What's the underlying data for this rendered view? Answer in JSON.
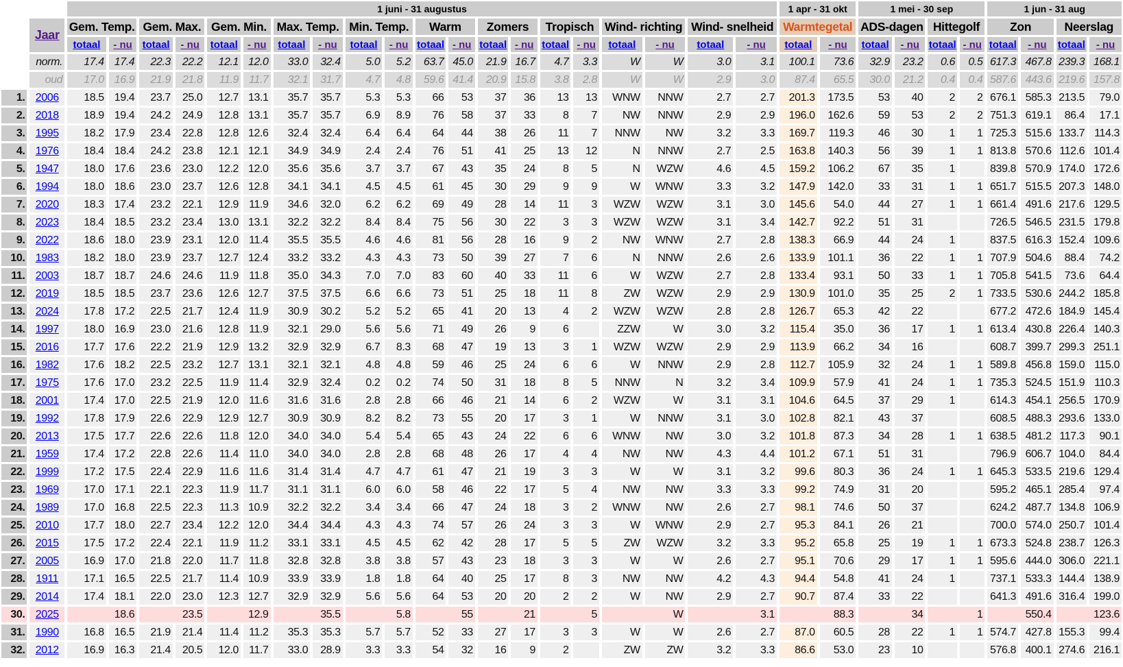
{
  "periods": [
    {
      "label": "1 juni - 31 augustus",
      "span": 10
    },
    {
      "label": "1 apr - 31 okt",
      "span": 1
    },
    {
      "label": "1 mei - 30 sep",
      "span": 2
    },
    {
      "label": "1 jun - 31 aug",
      "span": 2
    }
  ],
  "year_header": "Jaar",
  "columns": [
    "Gem. Temp.",
    "Gem. Max.",
    "Gem. Min.",
    "Max. Temp.",
    "Min. Temp.",
    "Warm",
    "Zomers",
    "Tropisch",
    "Wind- richting",
    "Wind- snelheid",
    "Warmtegetal",
    "ADS-dagen",
    "Hittegolf",
    "Zon",
    "Neerslag"
  ],
  "highlight_column": "Warmtegetal",
  "sub_labels": {
    "total": "totaal",
    "nu": "- nu"
  },
  "colors": {
    "header_bg": "#cccccc",
    "cell_bg": "#efefef",
    "highlight_text": "#d9541e",
    "highlight_cell": "#fdeedd",
    "current_row": "#ffdcdc"
  },
  "norm": {
    "label": "norm.",
    "values": [
      "17.4",
      "17.4",
      "22.3",
      "22.2",
      "12.1",
      "12.0",
      "33.0",
      "32.4",
      "5.0",
      "5.2",
      "63.7",
      "45.0",
      "21.9",
      "16.7",
      "4.7",
      "3.3",
      "W",
      "W",
      "3.0",
      "3.1",
      "100.1",
      "73.6",
      "32.9",
      "23.2",
      "0.6",
      "0.5",
      "617.3",
      "467.8",
      "239.3",
      "168.1"
    ]
  },
  "oud": {
    "label": "oud",
    "values": [
      "17.0",
      "16.9",
      "21.9",
      "21.8",
      "11.9",
      "11.7",
      "32.1",
      "31.7",
      "4.7",
      "4.8",
      "59.6",
      "41.4",
      "20.9",
      "15.8",
      "3.8",
      "2.8",
      "W",
      "W",
      "2.9",
      "3.0",
      "87.4",
      "65.5",
      "30.0",
      "21.2",
      "0.4",
      "0.4",
      "587.6",
      "443.6",
      "219.6",
      "157.8"
    ]
  },
  "rows": [
    {
      "rank": "1.",
      "year": "2006",
      "v": [
        "18.5",
        "19.4",
        "23.7",
        "25.0",
        "12.7",
        "13.1",
        "35.7",
        "35.7",
        "5.3",
        "5.3",
        "66",
        "53",
        "37",
        "36",
        "13",
        "13",
        "WNW",
        "NNW",
        "2.7",
        "2.7",
        "201.3",
        "173.5",
        "53",
        "40",
        "2",
        "2",
        "676.1",
        "585.3",
        "213.5",
        "79.0"
      ]
    },
    {
      "rank": "2.",
      "year": "2018",
      "v": [
        "18.9",
        "19.4",
        "24.2",
        "24.9",
        "12.8",
        "13.1",
        "35.7",
        "35.7",
        "6.9",
        "8.9",
        "76",
        "58",
        "37",
        "33",
        "8",
        "7",
        "NW",
        "NNW",
        "2.9",
        "2.9",
        "196.0",
        "162.6",
        "59",
        "53",
        "2",
        "2",
        "751.3",
        "619.1",
        "86.4",
        "17.1"
      ]
    },
    {
      "rank": "3.",
      "year": "1995",
      "v": [
        "18.2",
        "17.9",
        "23.4",
        "22.8",
        "12.8",
        "12.6",
        "32.4",
        "32.4",
        "6.4",
        "6.4",
        "64",
        "44",
        "38",
        "26",
        "11",
        "7",
        "NNW",
        "NW",
        "3.2",
        "3.3",
        "169.7",
        "119.3",
        "46",
        "30",
        "1",
        "1",
        "725.3",
        "515.6",
        "133.7",
        "114.3"
      ]
    },
    {
      "rank": "4.",
      "year": "1976",
      "v": [
        "18.4",
        "18.4",
        "24.2",
        "23.8",
        "12.1",
        "12.1",
        "34.9",
        "34.9",
        "2.4",
        "2.4",
        "76",
        "51",
        "41",
        "25",
        "13",
        "12",
        "N",
        "NNW",
        "2.7",
        "2.5",
        "163.8",
        "140.3",
        "56",
        "39",
        "1",
        "1",
        "813.8",
        "570.6",
        "112.6",
        "101.4"
      ]
    },
    {
      "rank": "5.",
      "year": "1947",
      "v": [
        "18.0",
        "17.6",
        "23.6",
        "23.0",
        "12.2",
        "12.0",
        "35.6",
        "35.6",
        "3.7",
        "3.7",
        "67",
        "43",
        "35",
        "24",
        "8",
        "5",
        "N",
        "WZW",
        "4.6",
        "4.5",
        "159.2",
        "106.2",
        "67",
        "35",
        "1",
        "",
        "839.8",
        "570.9",
        "174.0",
        "172.6"
      ]
    },
    {
      "rank": "6.",
      "year": "1994",
      "v": [
        "18.0",
        "18.6",
        "23.0",
        "23.7",
        "12.6",
        "12.8",
        "34.1",
        "34.1",
        "4.5",
        "4.5",
        "61",
        "45",
        "30",
        "29",
        "9",
        "9",
        "W",
        "WNW",
        "3.3",
        "3.2",
        "147.9",
        "142.0",
        "33",
        "31",
        "1",
        "1",
        "651.7",
        "515.5",
        "207.3",
        "148.0"
      ]
    },
    {
      "rank": "7.",
      "year": "2020",
      "v": [
        "18.3",
        "17.4",
        "23.2",
        "22.1",
        "12.9",
        "11.9",
        "34.6",
        "32.0",
        "6.2",
        "6.2",
        "69",
        "49",
        "28",
        "14",
        "11",
        "3",
        "WZW",
        "WZW",
        "3.1",
        "3.0",
        "145.6",
        "54.0",
        "44",
        "27",
        "1",
        "1",
        "661.4",
        "491.6",
        "217.6",
        "129.5"
      ]
    },
    {
      "rank": "8.",
      "year": "2023",
      "v": [
        "18.4",
        "18.5",
        "23.2",
        "23.4",
        "13.0",
        "13.1",
        "32.2",
        "32.2",
        "8.4",
        "8.4",
        "75",
        "56",
        "30",
        "22",
        "3",
        "3",
        "WZW",
        "WZW",
        "3.1",
        "3.4",
        "142.7",
        "92.2",
        "51",
        "31",
        "",
        "",
        "726.5",
        "546.5",
        "231.5",
        "179.8"
      ]
    },
    {
      "rank": "9.",
      "year": "2022",
      "v": [
        "18.6",
        "18.0",
        "23.9",
        "23.1",
        "12.0",
        "11.4",
        "35.5",
        "35.5",
        "4.6",
        "4.6",
        "81",
        "56",
        "28",
        "16",
        "9",
        "2",
        "NW",
        "WNW",
        "2.7",
        "2.8",
        "138.3",
        "66.9",
        "44",
        "24",
        "1",
        "",
        "837.5",
        "616.3",
        "152.4",
        "109.6"
      ]
    },
    {
      "rank": "10.",
      "year": "1983",
      "v": [
        "18.2",
        "18.0",
        "23.9",
        "23.7",
        "12.7",
        "12.4",
        "33.2",
        "33.2",
        "4.3",
        "4.3",
        "73",
        "50",
        "39",
        "27",
        "7",
        "6",
        "N",
        "NNW",
        "2.6",
        "2.6",
        "133.9",
        "101.1",
        "36",
        "22",
        "1",
        "1",
        "707.9",
        "504.6",
        "88.4",
        "74.2"
      ]
    },
    {
      "rank": "11.",
      "year": "2003",
      "v": [
        "18.7",
        "18.7",
        "24.6",
        "24.6",
        "11.9",
        "11.8",
        "35.0",
        "34.3",
        "7.0",
        "7.0",
        "83",
        "60",
        "40",
        "33",
        "11",
        "6",
        "W",
        "WZW",
        "2.7",
        "2.8",
        "133.4",
        "93.1",
        "50",
        "33",
        "1",
        "1",
        "705.8",
        "541.5",
        "73.6",
        "64.4"
      ]
    },
    {
      "rank": "12.",
      "year": "2019",
      "v": [
        "18.5",
        "18.5",
        "23.7",
        "23.6",
        "12.6",
        "12.7",
        "37.5",
        "37.5",
        "6.6",
        "6.6",
        "73",
        "51",
        "25",
        "18",
        "11",
        "8",
        "ZW",
        "WZW",
        "2.9",
        "2.9",
        "130.9",
        "101.0",
        "35",
        "25",
        "2",
        "1",
        "733.5",
        "530.6",
        "244.2",
        "185.8"
      ]
    },
    {
      "rank": "13.",
      "year": "2024",
      "v": [
        "17.8",
        "17.2",
        "22.5",
        "21.7",
        "12.4",
        "11.9",
        "30.9",
        "30.2",
        "5.2",
        "5.2",
        "65",
        "41",
        "20",
        "13",
        "4",
        "2",
        "WZW",
        "WZW",
        "2.8",
        "2.8",
        "126.7",
        "65.3",
        "42",
        "22",
        "",
        "",
        "677.2",
        "472.6",
        "184.9",
        "145.4"
      ]
    },
    {
      "rank": "14.",
      "year": "1997",
      "v": [
        "18.0",
        "16.9",
        "23.0",
        "21.6",
        "12.8",
        "11.9",
        "32.1",
        "29.0",
        "5.6",
        "5.6",
        "71",
        "49",
        "26",
        "9",
        "6",
        "",
        "ZZW",
        "W",
        "3.0",
        "3.2",
        "115.4",
        "35.0",
        "36",
        "17",
        "1",
        "1",
        "613.4",
        "430.8",
        "226.4",
        "140.3"
      ]
    },
    {
      "rank": "15.",
      "year": "2016",
      "v": [
        "17.7",
        "17.6",
        "22.2",
        "21.9",
        "12.9",
        "13.2",
        "32.9",
        "32.9",
        "6.7",
        "8.3",
        "68",
        "47",
        "19",
        "13",
        "3",
        "1",
        "WZW",
        "WZW",
        "2.9",
        "2.9",
        "113.9",
        "66.2",
        "34",
        "16",
        "",
        "",
        "608.7",
        "399.7",
        "299.3",
        "251.1"
      ]
    },
    {
      "rank": "16.",
      "year": "1982",
      "v": [
        "17.6",
        "18.2",
        "22.5",
        "23.2",
        "12.7",
        "13.1",
        "32.1",
        "32.1",
        "4.8",
        "4.8",
        "59",
        "46",
        "25",
        "24",
        "6",
        "6",
        "W",
        "NNW",
        "2.9",
        "2.8",
        "112.7",
        "105.9",
        "32",
        "24",
        "1",
        "1",
        "589.8",
        "456.8",
        "159.0",
        "115.0"
      ]
    },
    {
      "rank": "17.",
      "year": "1975",
      "v": [
        "17.6",
        "17.0",
        "23.2",
        "22.5",
        "11.9",
        "11.4",
        "32.9",
        "32.4",
        "0.2",
        "0.2",
        "74",
        "50",
        "31",
        "18",
        "8",
        "5",
        "NNW",
        "N",
        "3.2",
        "3.4",
        "109.9",
        "57.9",
        "41",
        "24",
        "1",
        "1",
        "735.3",
        "524.5",
        "151.9",
        "110.3"
      ]
    },
    {
      "rank": "18.",
      "year": "2001",
      "v": [
        "17.4",
        "17.0",
        "22.5",
        "21.9",
        "12.0",
        "11.6",
        "31.6",
        "31.6",
        "2.8",
        "2.8",
        "66",
        "46",
        "21",
        "14",
        "6",
        "2",
        "WZW",
        "W",
        "3.1",
        "3.1",
        "104.6",
        "64.5",
        "37",
        "29",
        "1",
        "",
        "614.3",
        "454.1",
        "256.5",
        "170.9"
      ]
    },
    {
      "rank": "19.",
      "year": "1992",
      "v": [
        "17.8",
        "17.9",
        "22.6",
        "22.9",
        "12.9",
        "12.7",
        "30.9",
        "30.9",
        "8.2",
        "8.2",
        "73",
        "55",
        "20",
        "17",
        "3",
        "1",
        "W",
        "NNW",
        "3.1",
        "3.0",
        "102.8",
        "82.1",
        "43",
        "37",
        "",
        "",
        "608.5",
        "488.3",
        "293.6",
        "133.0"
      ]
    },
    {
      "rank": "20.",
      "year": "2013",
      "v": [
        "17.5",
        "17.7",
        "22.6",
        "22.6",
        "11.8",
        "12.0",
        "34.0",
        "34.0",
        "5.4",
        "5.4",
        "65",
        "43",
        "24",
        "22",
        "6",
        "6",
        "WNW",
        "NW",
        "3.0",
        "3.2",
        "101.8",
        "87.3",
        "34",
        "28",
        "1",
        "1",
        "638.5",
        "481.2",
        "117.3",
        "90.1"
      ]
    },
    {
      "rank": "21.",
      "year": "1959",
      "v": [
        "17.4",
        "17.2",
        "22.8",
        "22.6",
        "11.4",
        "11.0",
        "34.0",
        "34.0",
        "2.8",
        "2.8",
        "68",
        "48",
        "26",
        "17",
        "4",
        "4",
        "NW",
        "NW",
        "4.3",
        "4.4",
        "101.2",
        "67.1",
        "51",
        "31",
        "",
        "",
        "796.9",
        "606.7",
        "104.0",
        "84.4"
      ]
    },
    {
      "rank": "22.",
      "year": "1999",
      "v": [
        "17.2",
        "17.5",
        "22.4",
        "22.9",
        "11.6",
        "11.6",
        "31.4",
        "31.4",
        "4.7",
        "4.7",
        "61",
        "47",
        "21",
        "19",
        "3",
        "3",
        "W",
        "W",
        "3.1",
        "3.2",
        "99.6",
        "80.3",
        "36",
        "24",
        "1",
        "1",
        "645.3",
        "533.5",
        "219.6",
        "129.4"
      ]
    },
    {
      "rank": "23.",
      "year": "1969",
      "v": [
        "17.0",
        "17.1",
        "22.1",
        "22.3",
        "11.9",
        "11.7",
        "31.1",
        "31.1",
        "6.0",
        "6.0",
        "58",
        "46",
        "22",
        "17",
        "5",
        "4",
        "NW",
        "NW",
        "3.3",
        "3.3",
        "99.2",
        "74.9",
        "31",
        "20",
        "",
        "",
        "595.2",
        "465.1",
        "285.4",
        "97.4"
      ]
    },
    {
      "rank": "24.",
      "year": "1989",
      "v": [
        "17.0",
        "16.8",
        "22.5",
        "22.3",
        "11.3",
        "10.9",
        "32.2",
        "32.2",
        "3.4",
        "3.4",
        "66",
        "47",
        "24",
        "18",
        "3",
        "2",
        "WNW",
        "NW",
        "2.6",
        "2.7",
        "98.1",
        "74.6",
        "50",
        "37",
        "",
        "",
        "624.2",
        "487.7",
        "134.8",
        "106.9"
      ]
    },
    {
      "rank": "25.",
      "year": "2010",
      "v": [
        "17.7",
        "18.0",
        "22.7",
        "23.4",
        "12.2",
        "12.0",
        "34.4",
        "34.4",
        "4.3",
        "4.3",
        "74",
        "57",
        "26",
        "24",
        "3",
        "3",
        "W",
        "WNW",
        "2.9",
        "2.7",
        "95.3",
        "84.1",
        "26",
        "21",
        "",
        "",
        "700.0",
        "574.0",
        "250.7",
        "101.4"
      ]
    },
    {
      "rank": "26.",
      "year": "2015",
      "v": [
        "17.5",
        "17.2",
        "22.4",
        "22.1",
        "11.9",
        "11.2",
        "33.1",
        "33.1",
        "4.5",
        "4.5",
        "62",
        "42",
        "28",
        "17",
        "5",
        "5",
        "ZW",
        "WZW",
        "3.2",
        "3.3",
        "95.2",
        "65.8",
        "25",
        "19",
        "1",
        "1",
        "673.3",
        "524.8",
        "238.7",
        "126.3"
      ]
    },
    {
      "rank": "27.",
      "year": "2005",
      "v": [
        "16.9",
        "17.0",
        "21.8",
        "22.0",
        "11.7",
        "11.8",
        "32.8",
        "32.8",
        "3.8",
        "3.8",
        "57",
        "43",
        "23",
        "18",
        "3",
        "3",
        "W",
        "W",
        "2.6",
        "2.7",
        "95.1",
        "70.6",
        "29",
        "17",
        "1",
        "1",
        "595.6",
        "444.0",
        "306.0",
        "221.1"
      ]
    },
    {
      "rank": "28.",
      "year": "1911",
      "v": [
        "17.1",
        "16.5",
        "22.5",
        "21.7",
        "11.4",
        "10.9",
        "33.9",
        "33.9",
        "1.8",
        "1.8",
        "64",
        "40",
        "25",
        "17",
        "8",
        "3",
        "NW",
        "NW",
        "4.2",
        "4.3",
        "94.4",
        "54.8",
        "41",
        "24",
        "1",
        "",
        "737.1",
        "533.3",
        "144.4",
        "138.9"
      ]
    },
    {
      "rank": "29.",
      "year": "2014",
      "v": [
        "17.4",
        "18.1",
        "22.0",
        "23.0",
        "12.3",
        "12.7",
        "32.9",
        "32.9",
        "5.6",
        "5.6",
        "64",
        "53",
        "20",
        "20",
        "2",
        "2",
        "W",
        "NW",
        "2.9",
        "2.7",
        "90.7",
        "87.4",
        "33",
        "22",
        "",
        "",
        "641.3",
        "491.6",
        "316.4",
        "199.0"
      ]
    },
    {
      "rank": "30.",
      "year": "2025",
      "current": true,
      "v": [
        "18.6",
        "23.5",
        "12.9",
        "35.5",
        "5.8",
        "55",
        "21",
        "5",
        "W",
        "3.1",
        "88.3",
        "34",
        "1",
        "550.4",
        "123.6"
      ]
    },
    {
      "rank": "31.",
      "year": "1990",
      "v": [
        "16.8",
        "16.5",
        "21.9",
        "21.4",
        "11.4",
        "11.2",
        "35.3",
        "35.3",
        "5.7",
        "5.7",
        "52",
        "33",
        "27",
        "17",
        "3",
        "3",
        "W",
        "W",
        "2.6",
        "2.7",
        "87.0",
        "60.5",
        "28",
        "22",
        "1",
        "1",
        "574.7",
        "427.8",
        "155.3",
        "99.4"
      ]
    },
    {
      "rank": "32.",
      "year": "2012",
      "v": [
        "16.9",
        "16.3",
        "21.4",
        "20.5",
        "12.0",
        "11.7",
        "33.0",
        "28.9",
        "3.3",
        "3.3",
        "54",
        "32",
        "16",
        "9",
        "2",
        "",
        "ZW",
        "ZW",
        "3.2",
        "3.3",
        "86.6",
        "53.0",
        "23",
        "10",
        "",
        "",
        "576.8",
        "400.1",
        "274.6",
        "216.1"
      ]
    }
  ]
}
